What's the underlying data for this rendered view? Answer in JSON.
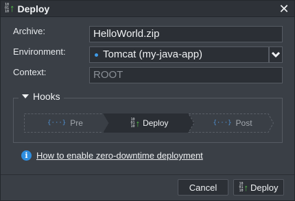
{
  "dialog": {
    "title": "Deploy",
    "close_icon": "close-icon",
    "title_icon": "binary-deploy-icon"
  },
  "form": {
    "archive_label": "Archive:",
    "archive_value": "HelloWorld.zip",
    "environment_label": "Environment:",
    "environment_value": "Tomcat (my-java-app)",
    "environment_status_color": "#3f9be8",
    "context_label": "Context:",
    "context_value": "ROOT"
  },
  "hooks": {
    "title": "Hooks",
    "steps": [
      {
        "label": "Pre",
        "icon": "ellipsis-braces-icon",
        "active": false
      },
      {
        "label": "Deploy",
        "icon": "binary-deploy-icon",
        "active": true
      },
      {
        "label": "Post",
        "icon": "ellipsis-braces-icon",
        "active": false
      }
    ]
  },
  "info": {
    "link_text": "How to enable zero-downtime deployment",
    "icon": "info-icon"
  },
  "buttons": {
    "cancel_label": "Cancel",
    "deploy_label": "Deploy"
  },
  "colors": {
    "accent_blue": "#2e8ee0",
    "deploy_arrow_green": "#55c44a",
    "background": "#3a3f46"
  }
}
